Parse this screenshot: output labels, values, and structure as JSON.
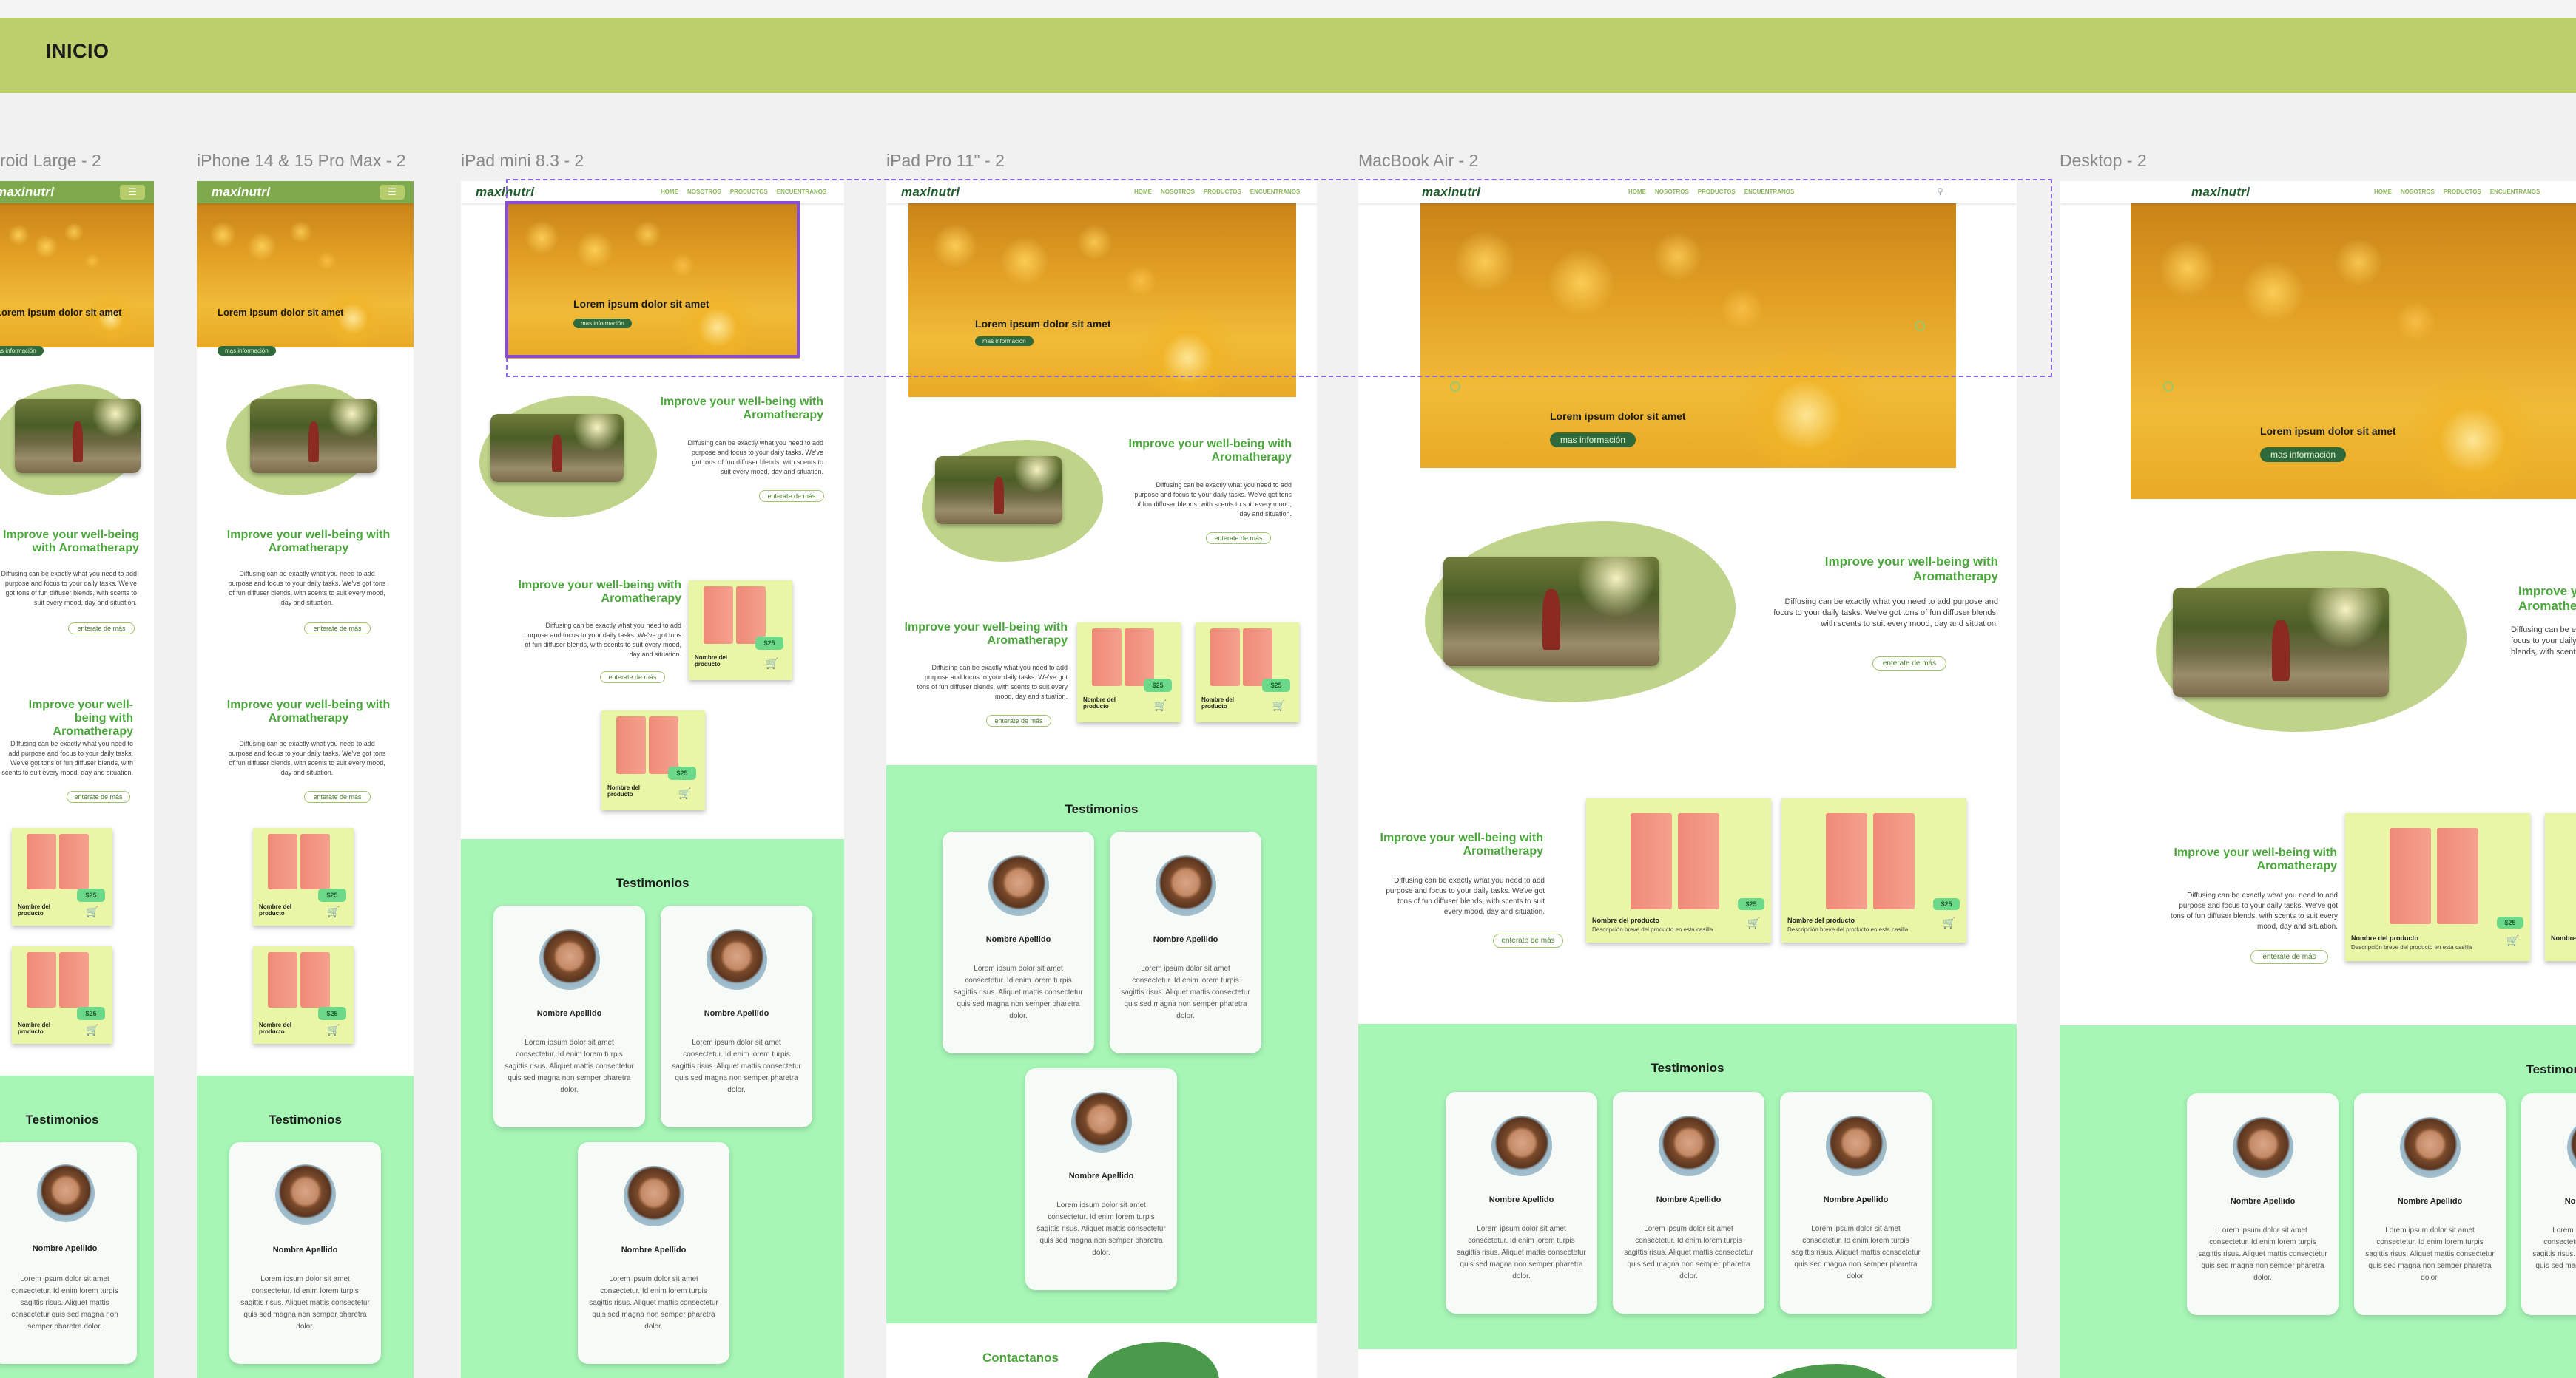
{
  "page_title": "INICIO",
  "frames": [
    {
      "label": "roid Large - 2"
    },
    {
      "label": "iPhone 14 & 15 Pro Max - 2"
    },
    {
      "label": "iPad mini 8.3 - 2"
    },
    {
      "label": "iPad Pro 11\" - 2"
    },
    {
      "label": "MacBook Air - 2"
    },
    {
      "label": "Desktop - 2"
    }
  ],
  "brand": {
    "logo": "maxinutri",
    "accent": "#bdcf6c",
    "green": "#4ba63c",
    "mint": "#a7f6b6"
  },
  "nav": {
    "links": [
      "HOME",
      "NOSOTROS",
      "PRODUCTOS",
      "ENCUENTRANOS"
    ],
    "menu_icon": "hamburger-icon",
    "search_icon": "search-icon"
  },
  "hero": {
    "title": "Lorem ipsum dolor sit amet",
    "button": "mas información"
  },
  "feature": {
    "title": "Improve your well-being with Aromatherapy",
    "text": "Diffusing can be exactly what you need to add purpose and focus to your daily tasks. We've got tons of fun diffuser blends, with scents to suit every mood, day and situation.",
    "button": "enterate de más"
  },
  "product": {
    "price": "$25",
    "name": "Nombre del producto",
    "desc": "Descripción breve del producto en esta casilla"
  },
  "testimonials": {
    "title": "Testimonios",
    "name": "Nombre Apellido",
    "text": "Lorem ipsum dolor sit amet consectetur. Id enim lorem turpis sagittis risus. Aliquet mattis consectetur quis sed magna non semper pharetra dolor."
  },
  "contact": {
    "title": "Contactanos"
  }
}
